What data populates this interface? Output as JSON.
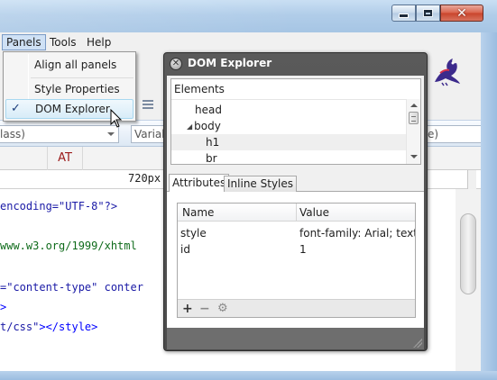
{
  "window": {
    "close_glyph": "✕"
  },
  "menubar": {
    "panels": "Panels",
    "tools": "Tools",
    "help": "Help"
  },
  "panels_menu": {
    "items": [
      {
        "label": "Align all panels",
        "checked": false
      },
      {
        "label": "Style Properties",
        "checked": false
      },
      {
        "label": "DOM Explorer",
        "checked": true
      }
    ],
    "check_glyph": "✓"
  },
  "selector_row": {
    "class_combo": "lass)",
    "var_combo": "Variab",
    "right_combo": "e)"
  },
  "tabs": {
    "at_label": "AT"
  },
  "ruler": {
    "value": "720px"
  },
  "code_lines": [
    {
      "pre": "",
      "str": "encoding=\"UTF-8\"?>",
      "post": ""
    },
    {
      "pre": "",
      "str": "",
      "green": "www.w3.org/1999/xhtml"
    },
    {
      "pre": "",
      "str": "=\"content-type\"",
      "post": " conter"
    },
    {
      "pre": "",
      "blue": ">"
    },
    {
      "pre": "",
      "str": "t/css\"",
      "blue": "></style>"
    }
  ],
  "dom_explorer": {
    "title": "DOM Explorer",
    "close_glyph": "✕",
    "elements_label": "Elements",
    "tree": [
      {
        "label": "head",
        "level": 1,
        "expanded": null
      },
      {
        "label": "body",
        "level": 1,
        "expanded": true
      },
      {
        "label": "h1",
        "level": 2,
        "selected": true
      },
      {
        "label": "br",
        "level": 2
      }
    ],
    "tabs": [
      {
        "label": "Attributes",
        "active": true
      },
      {
        "label": "Inline Styles",
        "active": false
      }
    ],
    "attributes": {
      "columns": [
        "Name",
        "Value"
      ],
      "rows": [
        {
          "name": "style",
          "value": "font-family: Arial; text-align: center;"
        },
        {
          "name": "id",
          "value": "1"
        }
      ]
    },
    "footer_tools": [
      "+",
      "−",
      "⚙"
    ]
  },
  "colors": {
    "titlebar": "#b1cde9",
    "panel_header": "#555555",
    "menu_highlight": "#cfe1f5",
    "code_string": "#1a1aa6",
    "code_url": "#0f6b1b",
    "code_tag": "#0000ff",
    "at_tab_text": "#9c1b1b"
  }
}
